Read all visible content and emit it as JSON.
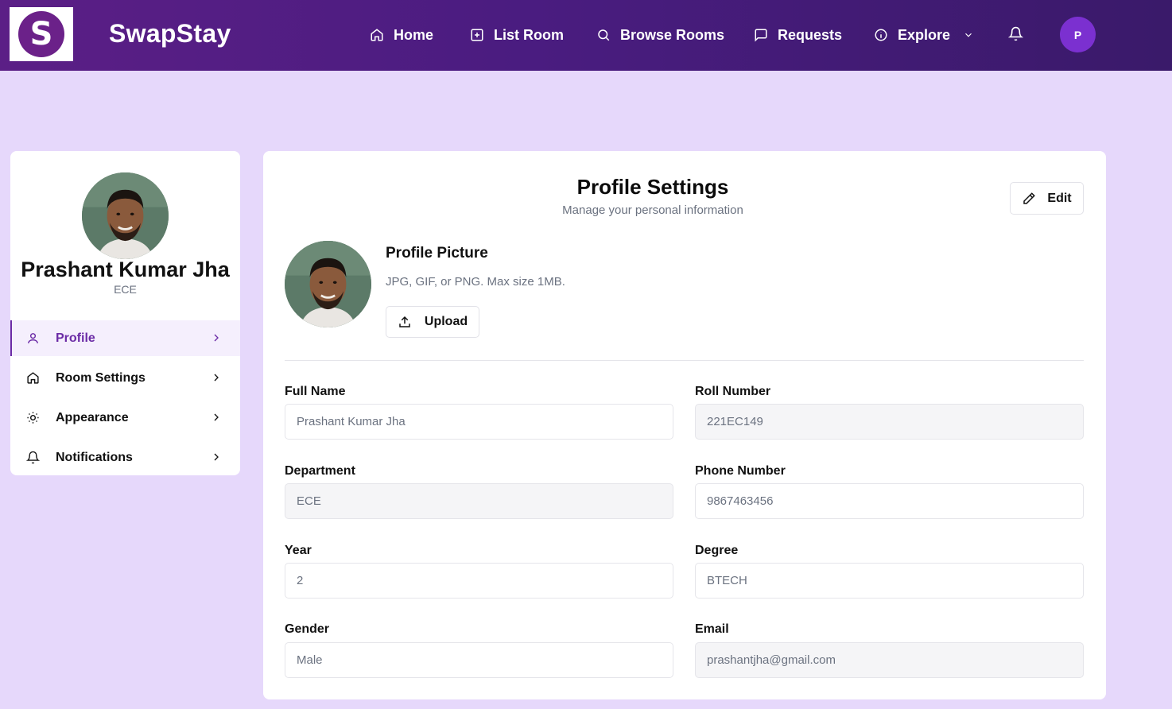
{
  "brand": {
    "logo_letter": "S",
    "name": "SwapStay"
  },
  "nav": {
    "items": [
      {
        "label": "Home",
        "icon": "home-icon"
      },
      {
        "label": "List Room",
        "icon": "plus-square-icon"
      },
      {
        "label": "Browse Rooms",
        "icon": "search-icon"
      },
      {
        "label": "Requests",
        "icon": "message-icon"
      },
      {
        "label": "Explore",
        "icon": "info-icon"
      }
    ],
    "avatar_initial": "P"
  },
  "sidebar": {
    "name": "Prashant Kumar Jha",
    "department": "ECE",
    "items": [
      {
        "label": "Profile",
        "icon": "user-icon",
        "active": true
      },
      {
        "label": "Room Settings",
        "icon": "home-icon"
      },
      {
        "label": "Appearance",
        "icon": "sun-icon"
      },
      {
        "label": "Notifications",
        "icon": "bell-icon"
      }
    ]
  },
  "main": {
    "title": "Profile Settings",
    "subtitle": "Manage your personal information",
    "edit_label": "Edit",
    "picture": {
      "title": "Profile Picture",
      "hint": "JPG, GIF, or PNG. Max size 1MB.",
      "upload_label": "Upload"
    },
    "fields": [
      {
        "label": "Full Name",
        "value": "Prashant Kumar Jha",
        "disabled": false
      },
      {
        "label": "Roll Number",
        "value": "221EC149",
        "disabled": true
      },
      {
        "label": "Department",
        "value": "ECE",
        "disabled": true
      },
      {
        "label": "Phone Number",
        "value": "9867463456",
        "disabled": false
      },
      {
        "label": "Year",
        "value": "2",
        "disabled": false
      },
      {
        "label": "Degree",
        "value": "BTECH",
        "disabled": false
      },
      {
        "label": "Gender",
        "value": "Male",
        "disabled": false
      },
      {
        "label": "Email",
        "value": "prashantjha@gmail.com",
        "disabled": true
      }
    ]
  },
  "colors": {
    "nav_start": "#5b1f86",
    "nav_end": "#3a1a6a",
    "page_bg": "#e6d8fb",
    "accent": "#6b2ba6",
    "avatar_bg": "#7b30d0"
  }
}
